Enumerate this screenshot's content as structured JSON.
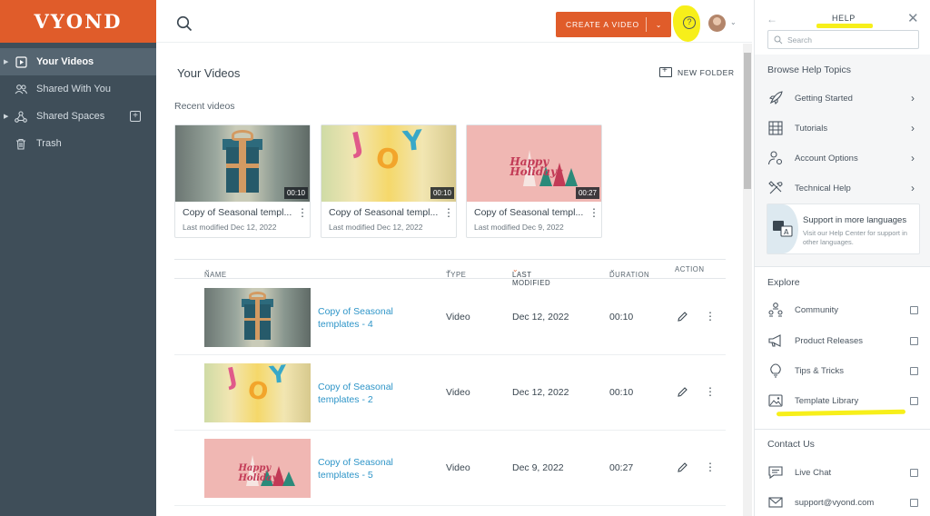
{
  "app": {
    "logo_text": "VYOND",
    "accent": "#e05c2a",
    "link_color": "#2e95c8"
  },
  "sidebar": {
    "items": [
      {
        "label": "Your Videos",
        "icon": "video-icon",
        "active": true,
        "expandable": true
      },
      {
        "label": "Shared With You",
        "icon": "people-icon",
        "active": false
      },
      {
        "label": "Shared Spaces",
        "icon": "network-icon",
        "active": false,
        "expandable": true,
        "add": true
      },
      {
        "label": "Trash",
        "icon": "trash-icon",
        "active": false
      }
    ]
  },
  "header": {
    "create_label": "CREATE A VIDEO",
    "help_glyph": "?"
  },
  "main": {
    "title": "Your Videos",
    "new_folder_label": "NEW FOLDER",
    "recent_label": "Recent videos",
    "recent": [
      {
        "title": "Copy of Seasonal templ...",
        "date": "Last modified Dec 12, 2022",
        "duration": "00:10",
        "thumb": "gift"
      },
      {
        "title": "Copy of Seasonal templ...",
        "date": "Last modified Dec 12, 2022",
        "duration": "00:10",
        "thumb": "joy"
      },
      {
        "title": "Copy of Seasonal templ...",
        "date": "Last modified Dec 9, 2022",
        "duration": "00:27",
        "thumb": "holidays"
      }
    ],
    "columns": {
      "name": "NAME",
      "type": "TYPE",
      "modified": "LAST MODIFIED",
      "duration": "DURATION",
      "action": "ACTION"
    },
    "rows": [
      {
        "name": "Copy of Seasonal templates - 4",
        "type": "Video",
        "modified": "Dec 12, 2022",
        "duration": "00:10",
        "thumb": "gift"
      },
      {
        "name": "Copy of Seasonal templates - 2",
        "type": "Video",
        "modified": "Dec 12, 2022",
        "duration": "00:10",
        "thumb": "joy"
      },
      {
        "name": "Copy of Seasonal templates - 5",
        "type": "Video",
        "modified": "Dec 9, 2022",
        "duration": "00:27",
        "thumb": "holidays"
      }
    ],
    "holidays_text": "Happy Holidays",
    "joy_letters": "JOY"
  },
  "help": {
    "title": "HELP",
    "search_placeholder": "Search",
    "browse_title": "Browse Help Topics",
    "topics": [
      {
        "label": "Getting Started",
        "icon": "rocket-icon"
      },
      {
        "label": "Tutorials",
        "icon": "film-icon"
      },
      {
        "label": "Account Options",
        "icon": "user-gear-icon"
      },
      {
        "label": "Technical Help",
        "icon": "tools-icon"
      }
    ],
    "lang_title": "Support in more languages",
    "lang_sub": "Visit our Help Center for support in other languages.",
    "explore_title": "Explore",
    "explore": [
      {
        "label": "Community",
        "icon": "community-icon"
      },
      {
        "label": "Product Releases",
        "icon": "megaphone-icon"
      },
      {
        "label": "Tips & Tricks",
        "icon": "lightbulb-icon"
      },
      {
        "label": "Template Library",
        "icon": "image-icon"
      }
    ],
    "contact_title": "Contact Us",
    "contact": [
      {
        "label": "Live Chat",
        "icon": "chat-icon"
      },
      {
        "label": "support@vyond.com",
        "icon": "mail-icon"
      }
    ]
  }
}
